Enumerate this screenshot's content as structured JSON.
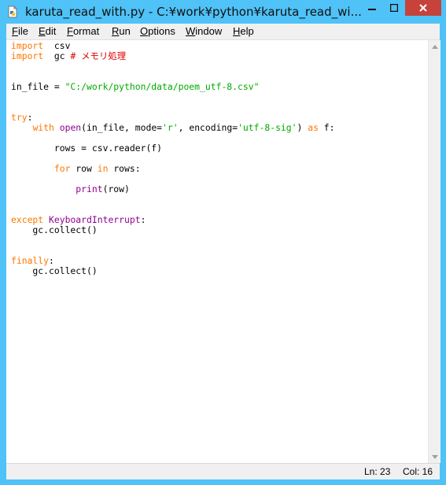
{
  "window": {
    "title": "karuta_read_with.py - C:¥work¥python¥karuta_read_wi..."
  },
  "menu": [
    {
      "label": "File",
      "accel": "F",
      "rest": "ile"
    },
    {
      "label": "Edit",
      "accel": "E",
      "rest": "dit"
    },
    {
      "label": "Format",
      "accel": "F",
      "rest": "ormat"
    },
    {
      "label": "Run",
      "accel": "R",
      "rest": "un"
    },
    {
      "label": "Options",
      "accel": "O",
      "rest": "ptions"
    },
    {
      "label": "Window",
      "accel": "W",
      "rest": "indow"
    },
    {
      "label": "Help",
      "accel": "H",
      "rest": "elp"
    }
  ],
  "code": [
    [
      [
        "kw",
        "import"
      ],
      [
        "",
        "  csv"
      ]
    ],
    [
      [
        "kw",
        "import"
      ],
      [
        "",
        "  gc "
      ],
      [
        "cm",
        "# メモリ処理"
      ]
    ],
    [],
    [],
    [
      [
        "",
        "in_file = "
      ],
      [
        "str",
        "\"C:/work/python/data/poem_utf-8.csv\""
      ]
    ],
    [],
    [],
    [
      [
        "kw",
        "try"
      ],
      [
        "",
        ":"
      ]
    ],
    [
      [
        "",
        "    "
      ],
      [
        "kw",
        "with"
      ],
      [
        "",
        " "
      ],
      [
        "bi",
        "open"
      ],
      [
        "",
        "(in_file, mode="
      ],
      [
        "str",
        "'r'"
      ],
      [
        "",
        ", encoding="
      ],
      [
        "str",
        "'utf-8-sig'"
      ],
      [
        "",
        ") "
      ],
      [
        "kw",
        "as"
      ],
      [
        "",
        " f:"
      ]
    ],
    [],
    [
      [
        "",
        "        rows = csv.reader(f)"
      ]
    ],
    [],
    [
      [
        "",
        "        "
      ],
      [
        "kw",
        "for"
      ],
      [
        "",
        " row "
      ],
      [
        "kw",
        "in"
      ],
      [
        "",
        " rows:"
      ]
    ],
    [],
    [
      [
        "",
        "            "
      ],
      [
        "bi",
        "print"
      ],
      [
        "",
        "(row)"
      ]
    ],
    [],
    [],
    [
      [
        "kw",
        "except"
      ],
      [
        "",
        " "
      ],
      [
        "bi",
        "KeyboardInterrupt"
      ],
      [
        "",
        ":"
      ]
    ],
    [
      [
        "",
        "    gc.collect()"
      ]
    ],
    [],
    [],
    [
      [
        "kw",
        "finally"
      ],
      [
        "",
        ":"
      ]
    ],
    [
      [
        "",
        "    gc.collect()"
      ]
    ]
  ],
  "status": {
    "line": "Ln: 23",
    "col": "Col: 16"
  }
}
